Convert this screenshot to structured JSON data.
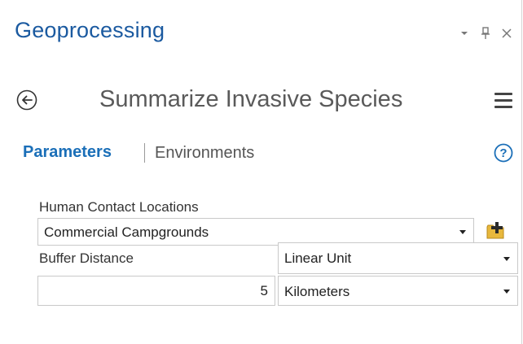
{
  "pane": {
    "title": "Geoprocessing",
    "controls": [
      "pane-options-icon",
      "pin-icon",
      "close-icon"
    ]
  },
  "tool": {
    "title": "Summarize Invasive Species",
    "back_icon": "back-arrow-icon",
    "menu_icon": "hamburger-menu-icon"
  },
  "tabs": {
    "parameters": "Parameters",
    "environments": "Environments",
    "active": "Parameters",
    "help_icon": "help-icon"
  },
  "params": {
    "contact": {
      "label": "Human Contact Locations",
      "value": "Commercial Campgrounds",
      "browse_icon": "add-data-folder-icon"
    },
    "buffer": {
      "label": "Buffer Distance",
      "unit_type": "Linear Unit",
      "distance": "5",
      "units": "Kilometers"
    }
  },
  "colors": {
    "title": "#1b5aa0",
    "active_tab": "#1b6fb8",
    "folder_icon": "#e8b83c"
  }
}
